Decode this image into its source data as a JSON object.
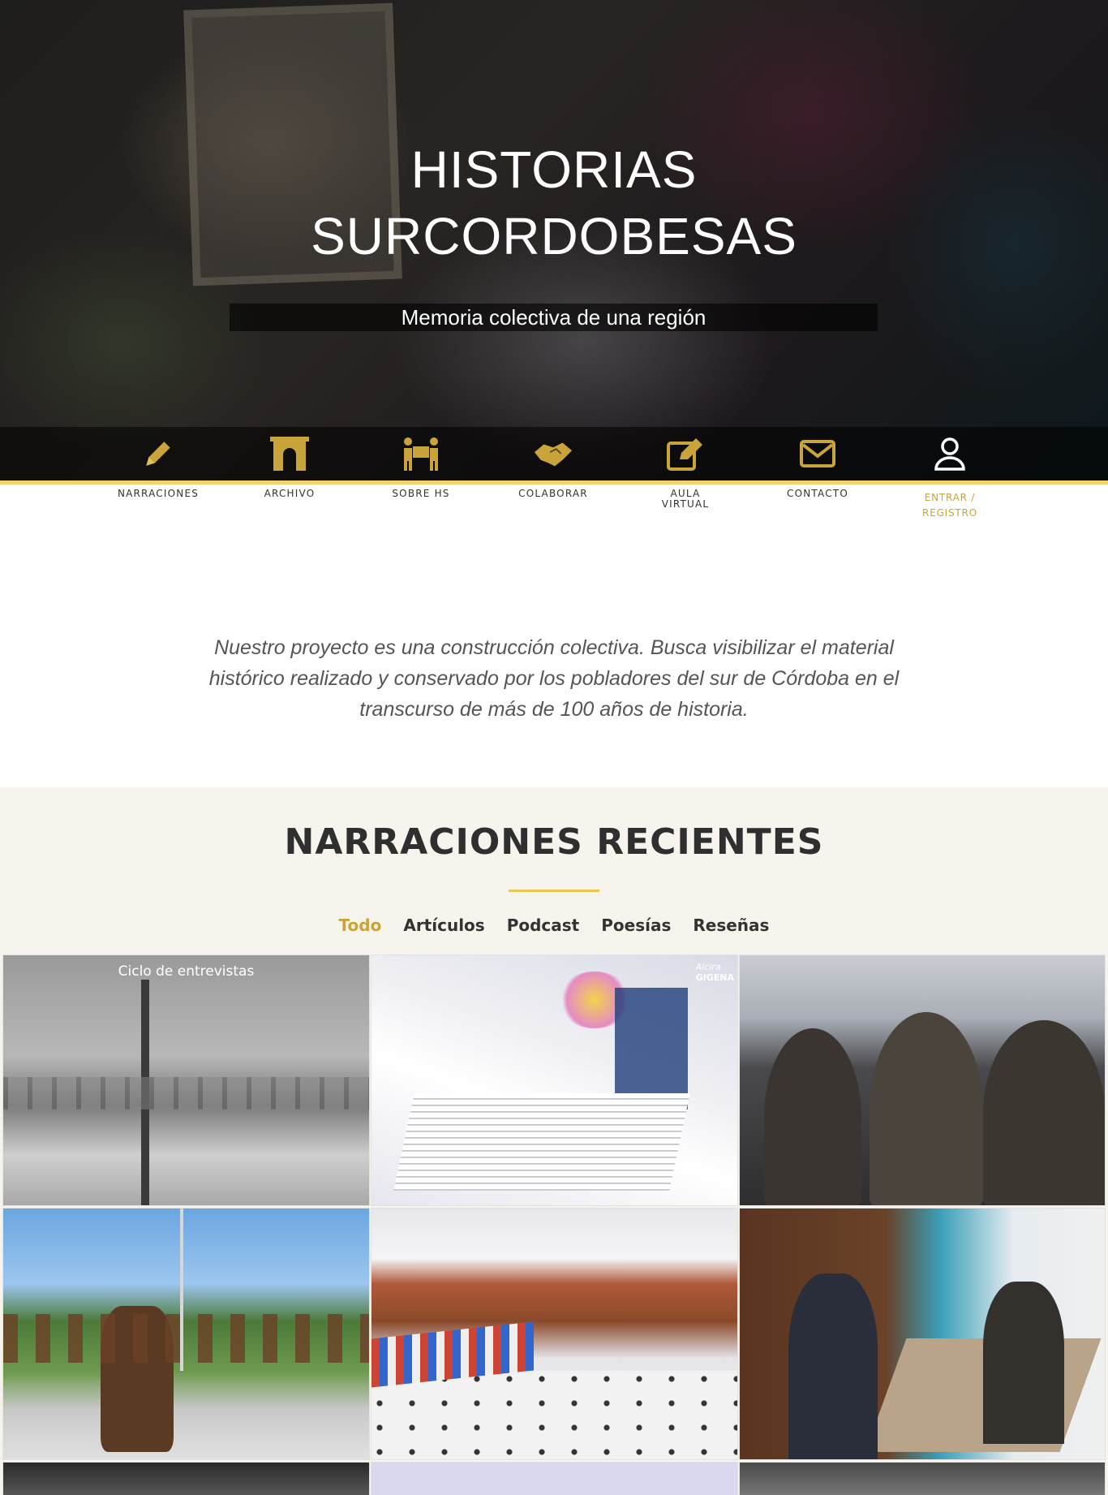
{
  "hero": {
    "title_line1": "HISTORIAS",
    "title_line2": "SURCORDOBESAS",
    "subtitle": "Memoria colectiva de una región"
  },
  "nav": {
    "accent_color": "#c9a43a",
    "items": [
      {
        "label": "NARRACIONES",
        "icon": "pencil-icon"
      },
      {
        "label": "ARCHIVO",
        "icon": "archway-icon"
      },
      {
        "label": "SOBRE HS",
        "icon": "people-carry-icon"
      },
      {
        "label": "COLABORAR",
        "icon": "handshake-icon"
      },
      {
        "label_line1": "AULA",
        "label_line2": "VIRTUAL",
        "icon": "edit-icon"
      },
      {
        "label": "CONTACTO",
        "icon": "envelope-icon"
      },
      {
        "label_line1": "ENTRAR /",
        "label_line2": "REGISTRO",
        "icon": "user-icon"
      }
    ]
  },
  "intro": {
    "text": "Nuestro proyecto es una construcción colectiva. Busca visibilizar el material histórico realizado y conservado por los pobladores del sur de Córdoba en el transcurso de más de 100 años de historia."
  },
  "recent": {
    "title": "NARRACIONES RECIENTES",
    "filters": [
      "Todo",
      "Artículos",
      "Podcast",
      "Poesías",
      "Reseñas"
    ],
    "active_filter": "Todo",
    "tiles": [
      {
        "caption": "Ciclo de entrevistas",
        "subject": "snowy-street-photo"
      },
      {
        "caption": "",
        "subject": "books-stack-photo",
        "badge_line1": "Alcira",
        "badge_line2": "GIGENA"
      },
      {
        "caption": "",
        "subject": "officials-photo"
      },
      {
        "caption": "",
        "subject": "horse-riders-photo"
      },
      {
        "caption": "",
        "subject": "library-fair-photo"
      },
      {
        "caption": "",
        "subject": "book-presentation-photo"
      },
      {
        "caption": "",
        "subject": "portrait-photo"
      },
      {
        "caption": "",
        "subject": "lavender-photo"
      },
      {
        "caption": "",
        "subject": "gray-photo"
      }
    ]
  }
}
